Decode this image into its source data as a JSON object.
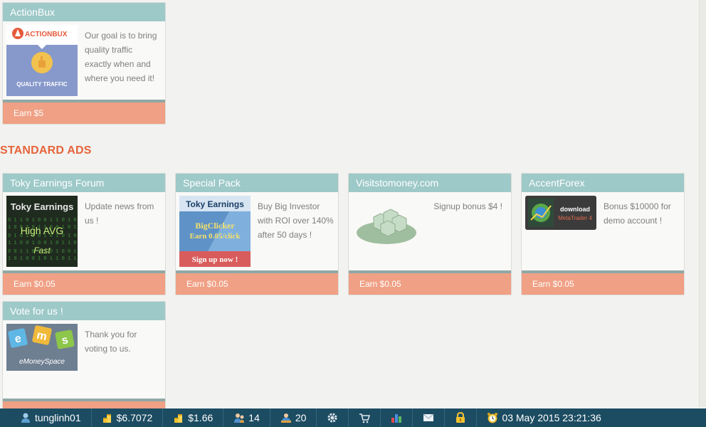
{
  "top_cards": [
    {
      "title": "ActionBux",
      "description": "Our goal is to bring quality traffic exactly when and where you need it!",
      "earn": "Earn $5",
      "thumb": {
        "brand": "ACTIONBUX",
        "caption": "QUALITY TRAFFIC"
      }
    }
  ],
  "section": {
    "title": "STANDARD ADS"
  },
  "ads": [
    {
      "title": "Toky Earnings Forum",
      "description": "Update news from us !",
      "earn": "Earn $0.05",
      "thumb": {
        "line1": "Toky Earnings",
        "line2": "High AVG",
        "line3": "Fast"
      }
    },
    {
      "title": "Special Pack",
      "description": "Buy Big Investor with ROI over 140% after 50 days !",
      "earn": "Earn $0.05",
      "thumb": {
        "line1": "Toky Earnings",
        "line2": "BigClicker",
        "line3": "Earn 0.05/click",
        "line4": "Sign up now !"
      }
    },
    {
      "title": "Visitstomoney.com",
      "description": "Signup bonus $4 !",
      "earn": "Earn $0.05"
    },
    {
      "title": "AccentForex",
      "description": "Bonus $10000 for demo account !",
      "earn": "Earn $0.05",
      "thumb": {
        "line1": "download",
        "line2": "MetaTrader 4"
      }
    },
    {
      "title": "Vote for us !",
      "description": "Thank you for voting to us.",
      "earn": "",
      "thumb": {
        "letters": [
          "e",
          "m",
          "s"
        ],
        "caption": "eMoneySpace"
      }
    }
  ],
  "bottom_bar": {
    "username": "tunglinh01",
    "balance": "$6.7072",
    "balance2": "$1.66",
    "referrals": "14",
    "rented": "20",
    "datetime": "03 May 2015 23:21:36"
  }
}
